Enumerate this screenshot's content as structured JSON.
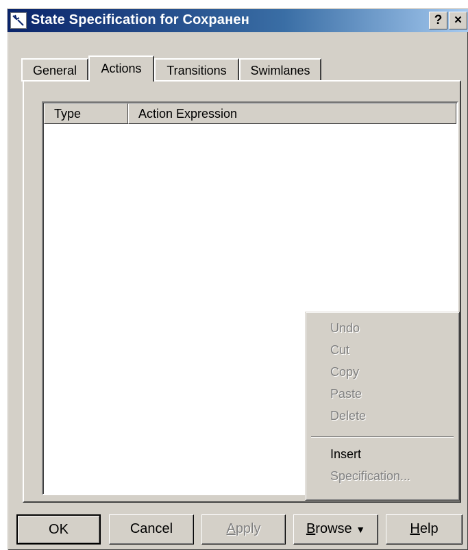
{
  "window": {
    "title": "State Specification for Сохранен",
    "help_button": "?",
    "close_button": "×"
  },
  "tabs": [
    {
      "label": "General"
    },
    {
      "label": "Actions"
    },
    {
      "label": "Transitions"
    },
    {
      "label": "Swimlanes"
    }
  ],
  "active_tab": "Actions",
  "list": {
    "columns": [
      {
        "label": "Type"
      },
      {
        "label": "Action Expression"
      }
    ],
    "rows": []
  },
  "context_menu": {
    "items": [
      {
        "label": "Undo",
        "enabled": false
      },
      {
        "label": "Cut",
        "enabled": false
      },
      {
        "label": "Copy",
        "enabled": false
      },
      {
        "label": "Paste",
        "enabled": false
      },
      {
        "label": "Delete",
        "enabled": false
      },
      {
        "label": "Insert",
        "enabled": true
      },
      {
        "label": "Specification...",
        "enabled": false
      }
    ]
  },
  "buttons": {
    "ok": "OK",
    "cancel": "Cancel",
    "apply_first": "A",
    "apply_rest": "pply",
    "browse_first": "B",
    "browse_rest": "rowse",
    "browse_arrow": "▼",
    "help_first": "H",
    "help_rest": "elp"
  },
  "colors": {
    "face": "#d4d0c8",
    "title_start": "#0a246a",
    "title_end": "#a6caf0",
    "disabled_text": "#808080"
  }
}
